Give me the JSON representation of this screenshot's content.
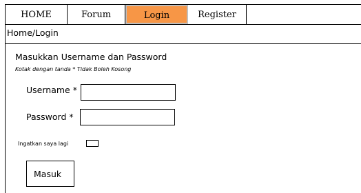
{
  "nav": {
    "items": [
      {
        "label": "HOME"
      },
      {
        "label": "Forum"
      },
      {
        "label": "Login"
      },
      {
        "label": "Register"
      }
    ],
    "active": "Login",
    "active_color": "#f79646"
  },
  "breadcrumb": "Home/Login",
  "form": {
    "heading": "Masukkan Username dan Password",
    "note": "Kotak dengan tanda  * Tidak Boleh Kosong",
    "username_label": "Username *",
    "username_value": "",
    "password_label": "Password *",
    "password_value": "",
    "remember_label": "Ingatkan saya lagi",
    "remember_checked": false,
    "submit_label": "Masuk"
  }
}
